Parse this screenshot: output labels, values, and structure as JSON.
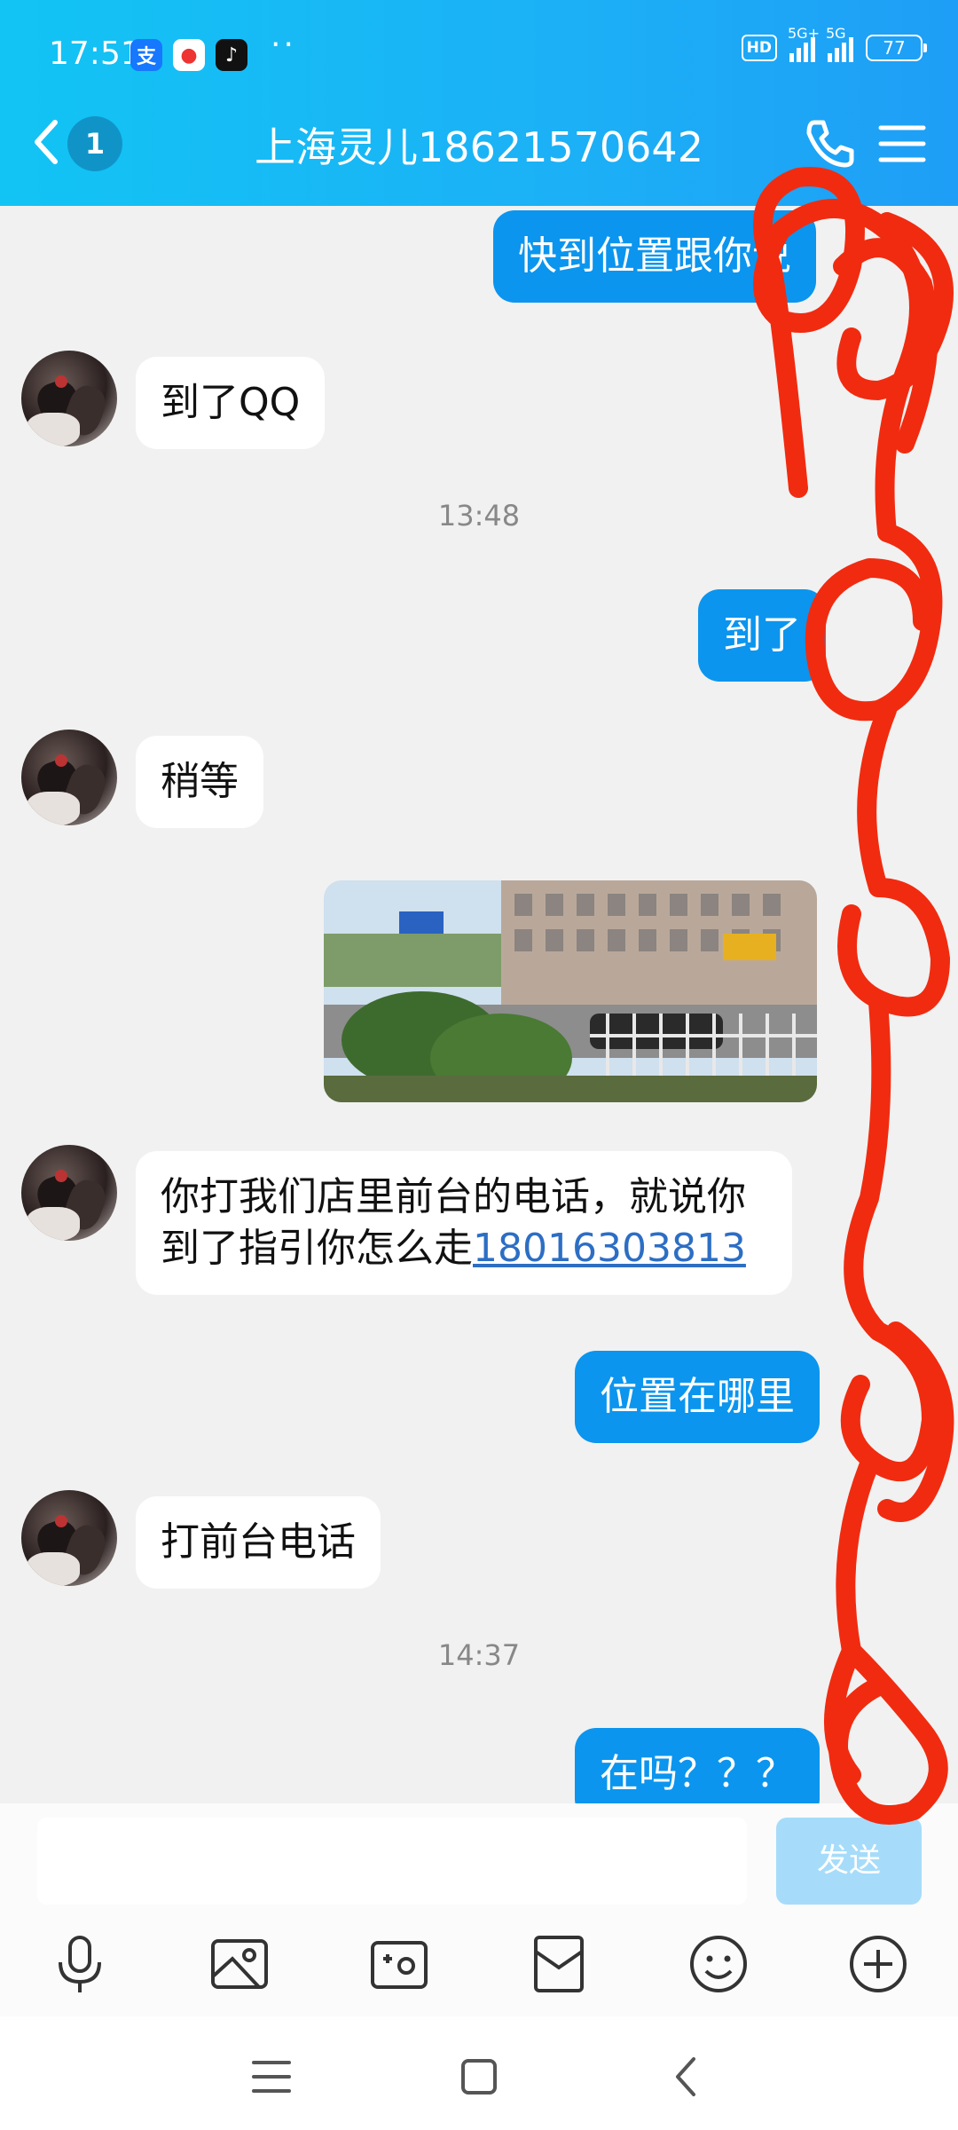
{
  "status_bar": {
    "time": "17:51",
    "hd_label": "HD",
    "network_1": "5G+",
    "network_2": "5G",
    "battery": "77",
    "app_icons": [
      "alipay-icon",
      "app-red-icon",
      "tiktok-icon"
    ]
  },
  "header": {
    "unread_count": "1",
    "title": "上海灵儿18621570642"
  },
  "messages": [
    {
      "side": "right",
      "text": "快到位置跟你说"
    },
    {
      "side": "left",
      "text": "到了QQ"
    },
    {
      "type": "timestamp",
      "text": "13:48"
    },
    {
      "side": "right",
      "text": "到了"
    },
    {
      "side": "left",
      "text": "稍等"
    },
    {
      "side": "right",
      "type": "image",
      "icon": "street-photo"
    },
    {
      "side": "left",
      "text_line1": "你打我们店里前台的电话，就说你",
      "text_line2": "到了指引你怎么走",
      "phone_link": "18016303813"
    },
    {
      "side": "right",
      "text": "位置在哪里"
    },
    {
      "side": "left",
      "text": "打前台电话"
    },
    {
      "type": "timestamp",
      "text": "14:37"
    },
    {
      "side": "right",
      "text": "在吗？？？"
    }
  ],
  "input": {
    "placeholder": "",
    "send_label": "发送"
  },
  "toolbar": [
    "microphone-icon",
    "image-icon",
    "camera-icon",
    "red-envelope-icon",
    "emoji-icon",
    "plus-icon"
  ],
  "nav": [
    "menu-icon",
    "home-icon",
    "back-icon"
  ],
  "colors": {
    "header_accent": "#1cb0f6",
    "bubble_right": "#0b95ee",
    "send_disabled": "#a6dcfa",
    "scribble": "#f12b10"
  }
}
